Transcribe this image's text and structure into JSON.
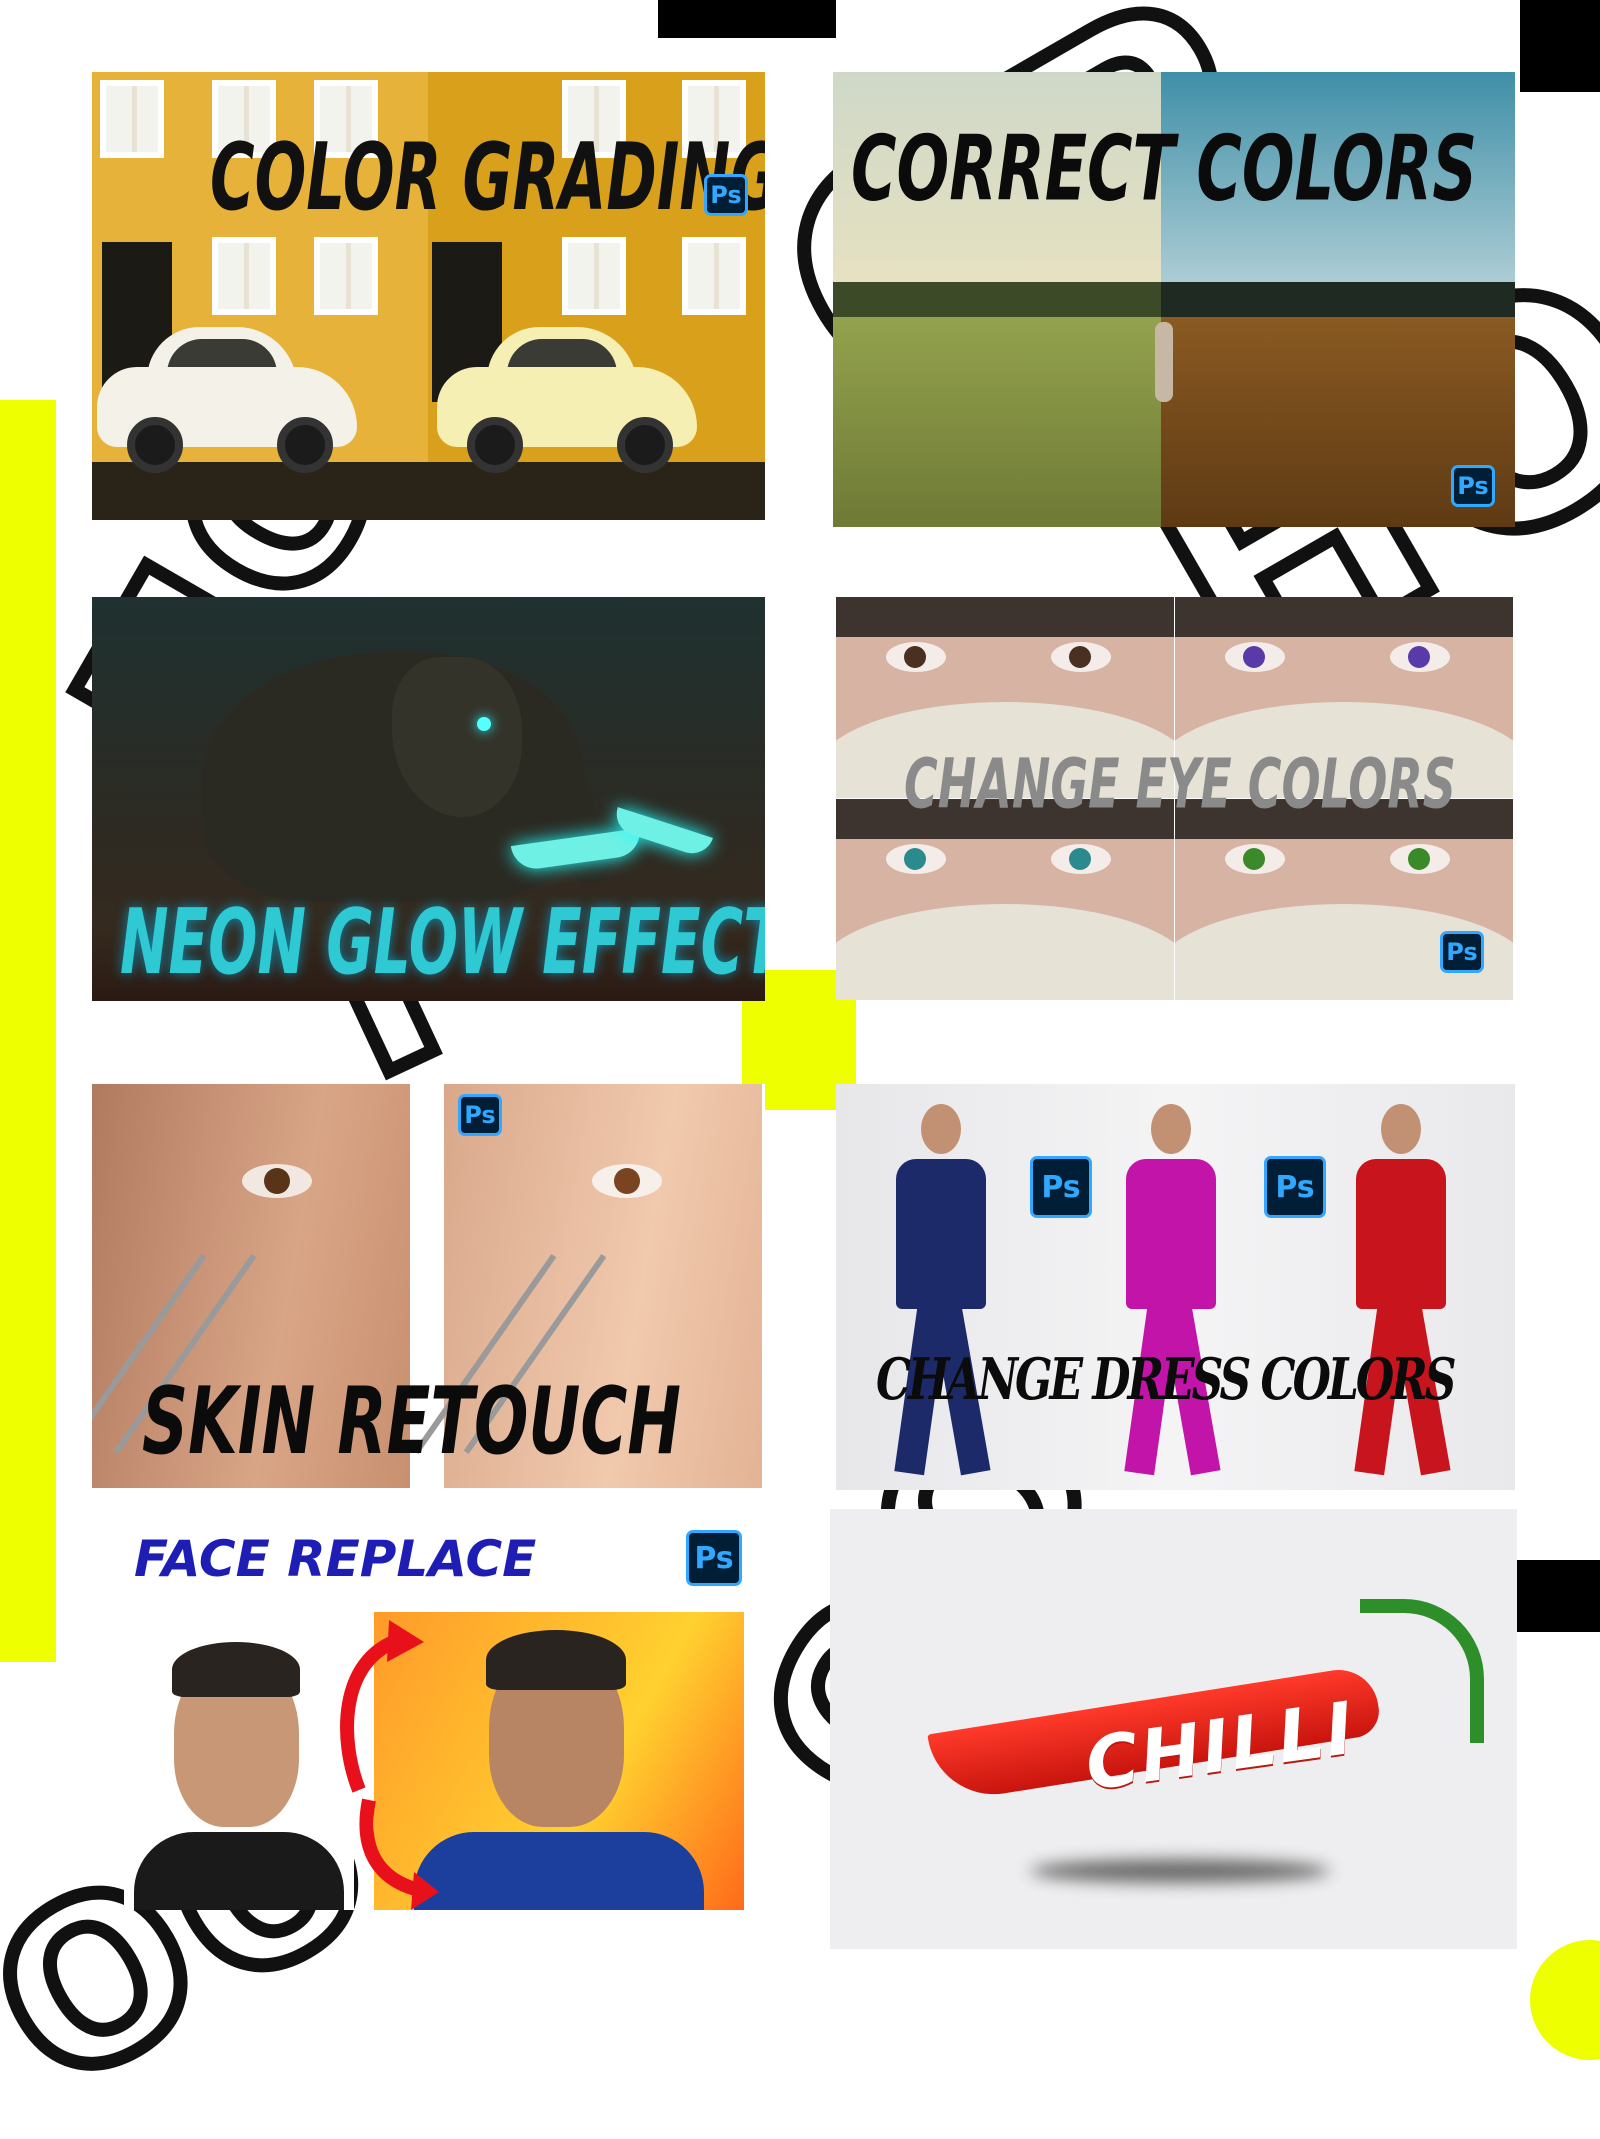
{
  "colors": {
    "accent_yellow": "#eeff00",
    "black": "#000000",
    "ps_navy": "#001e36",
    "ps_blue": "#31a8ff",
    "neon_cyan": "#3fd6e0",
    "face_title_blue": "#1e1eb4"
  },
  "ps_badge_label": "Ps",
  "tiles": [
    {
      "id": "color-grading",
      "title": "COLOR GRADING",
      "icon": "photoshop-icon"
    },
    {
      "id": "correct-colors",
      "title": "CORRECT COLORS",
      "icon": "photoshop-icon"
    },
    {
      "id": "neon-glow",
      "title": "NEON GLOW EFFECT"
    },
    {
      "id": "eye-colors",
      "title": "CHANGE EYE COLORS",
      "icon": "photoshop-icon"
    },
    {
      "id": "skin-retouch",
      "title": "SKIN RETOUCH",
      "icon": "photoshop-icon"
    },
    {
      "id": "dress-colors",
      "title": "CHANGE DRESS COLORS",
      "icon": "photoshop-icon"
    },
    {
      "id": "face-replace",
      "title": "FACE REPLACE",
      "icon": "photoshop-icon"
    },
    {
      "id": "chilli",
      "title": "CHILLI"
    }
  ]
}
